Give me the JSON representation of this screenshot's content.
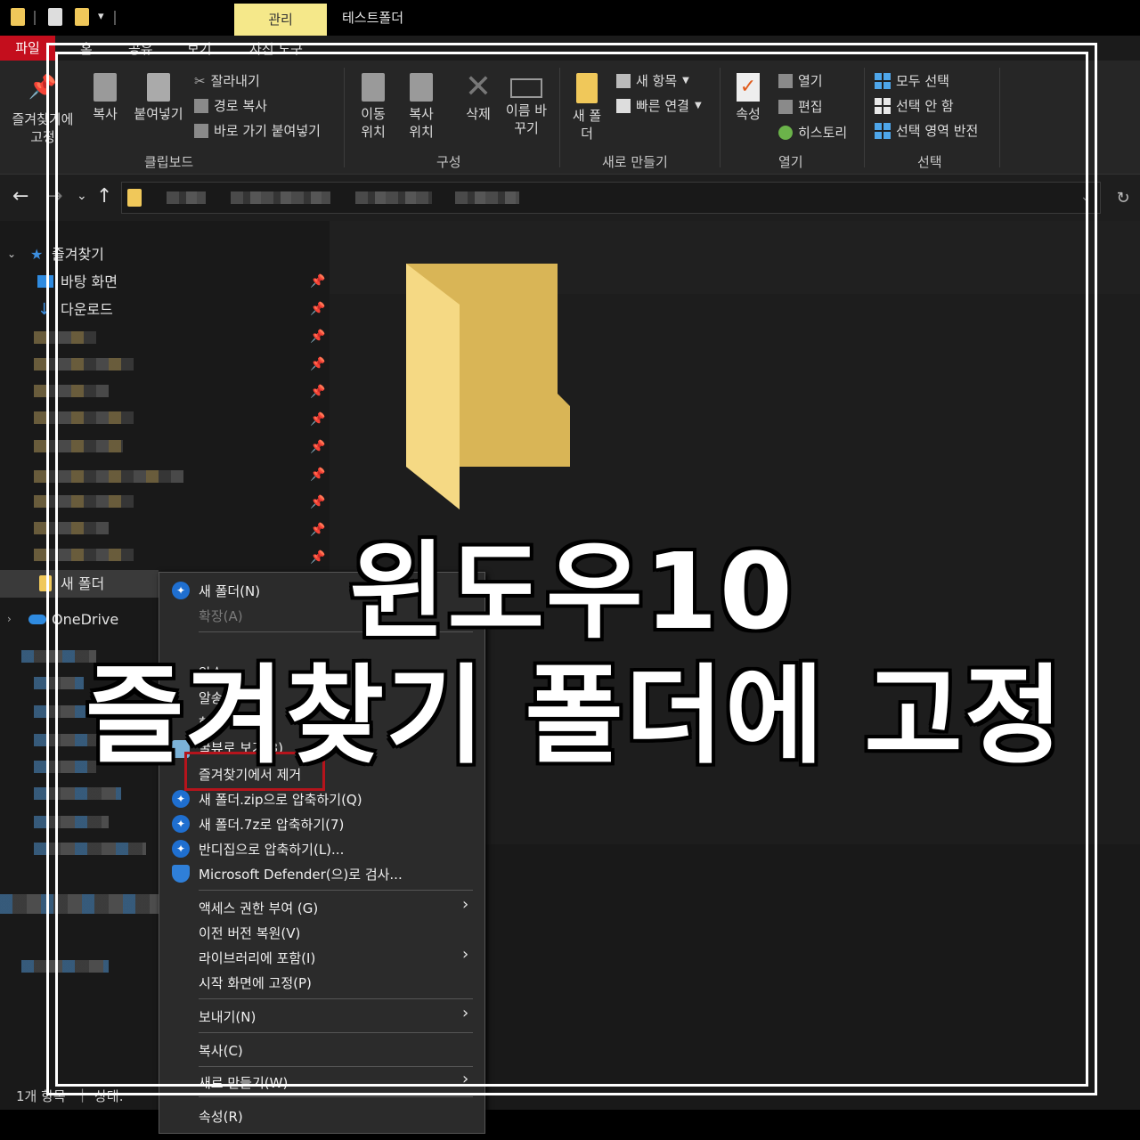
{
  "titlebar": {
    "manage_tab": "관리",
    "window_title": "테스트폴더"
  },
  "ribbon_tabs": [
    "파일",
    "홈",
    "공유",
    "보기",
    "사진 도구"
  ],
  "ribbon": {
    "clipboard": {
      "pin_label": "즐겨찾기에 고정",
      "copy_label": "복사",
      "paste_label": "붙여넣기",
      "cut_label": "잘라내기",
      "copy_path_label": "경로 복사",
      "paste_shortcut_label": "바로 가기 붙여넣기",
      "group_label": "클립보드"
    },
    "organize": {
      "move_label": "이동 위치",
      "copy_to_label": "복사 위치",
      "delete_label": "삭제",
      "rename_label": "이름 바꾸기",
      "group_label": "구성"
    },
    "new": {
      "new_folder_label": "새 폴더",
      "new_item_label": "새 항목",
      "easy_access_label": "빠른 연결",
      "group_label": "새로 만들기"
    },
    "open": {
      "properties_label": "속성",
      "open_label": "열기",
      "edit_label": "편집",
      "history_label": "히스토리",
      "group_label": "열기"
    },
    "select": {
      "select_all_label": "모두 선택",
      "select_none_label": "선택 안 함",
      "invert_label": "선택 영역 반전",
      "group_label": "선택"
    }
  },
  "navpane": {
    "quick_access": "즐겨찾기",
    "desktop": "바탕 화면",
    "downloads": "다운로드",
    "new_folder": "새 폴더",
    "onedrive": "OneDrive"
  },
  "statusbar": {
    "item_count": "1개 항목",
    "state": "상태:"
  },
  "context_menu": {
    "new_folder": "새 폴더(N)",
    "expand": "확장(A)",
    "alzip_1": "알송",
    "alzip_2": "알송",
    "hangul": "한글",
    "honeyview": "꿀뷰로 보기(3)",
    "remove_from_quick_access": "즐겨찾기에서 제거",
    "zip": "새 폴더.zip으로 압축하기(Q)",
    "sevenz": "새 폴더.7z로 압축하기(7)",
    "bandizip": "반디집으로 압축하기(L)...",
    "defender": "Microsoft Defender(으)로 검사...",
    "give_access": "액세스 권한 부여 (G)",
    "restore_versions": "이전 버전 복원(V)",
    "include_library": "라이브러리에 포함(I)",
    "pin_start": "시작 화면에 고정(P)",
    "send_to": "보내기(N)",
    "copy": "복사(C)",
    "new": "새로 만들기(W)",
    "properties": "속성(R)"
  },
  "headline": {
    "line1": "윈도우10",
    "line2": "즐겨찾기 폴더에 고정"
  },
  "colors": {
    "file_tab": "#c40e1d",
    "manage_tab": "#f5e88a",
    "folder": "#f0c85a",
    "highlight_box": "#b5141c",
    "accent_blue": "#4ea6ea"
  }
}
